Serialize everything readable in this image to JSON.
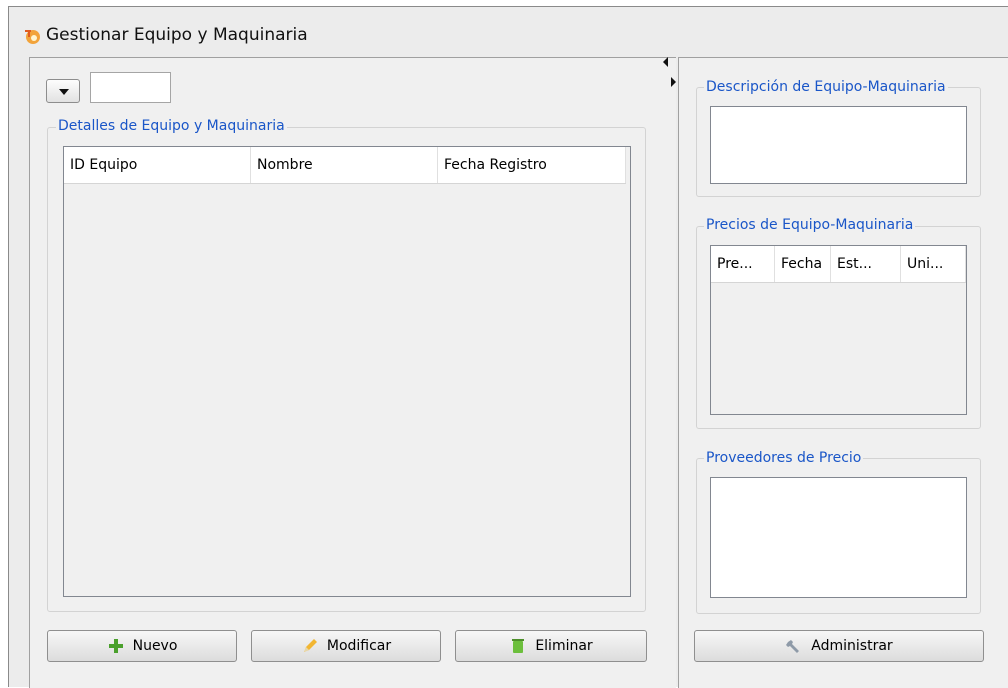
{
  "window": {
    "title": "Gestionar Equipo y Maquinaria"
  },
  "left": {
    "details_group_label": "Detalles de Equipo y Maquinaria",
    "table_columns": [
      "ID Equipo",
      "Nombre",
      "Fecha Registro"
    ],
    "buttons": {
      "new": "Nuevo",
      "edit": "Modificar",
      "delete": "Eliminar"
    }
  },
  "right": {
    "description_group_label": "Descripción de Equipo-Maquinaria",
    "prices_group_label": "Precios de Equipo-Maquinaria",
    "prices_columns": [
      "Pre...",
      "Fecha",
      "Est...",
      "Uni..."
    ],
    "suppliers_group_label": "Proveedores de Precio",
    "admin_button": "Administrar"
  },
  "icons": {
    "app": "app-logo-icon",
    "new": "plus-icon",
    "edit": "pencil-icon",
    "delete": "trash-icon",
    "admin": "wrench-icon",
    "dropdown": "chevron-down-icon"
  },
  "colors": {
    "group_label": "#1a56c8",
    "panel_bg": "#f0f0f0"
  }
}
